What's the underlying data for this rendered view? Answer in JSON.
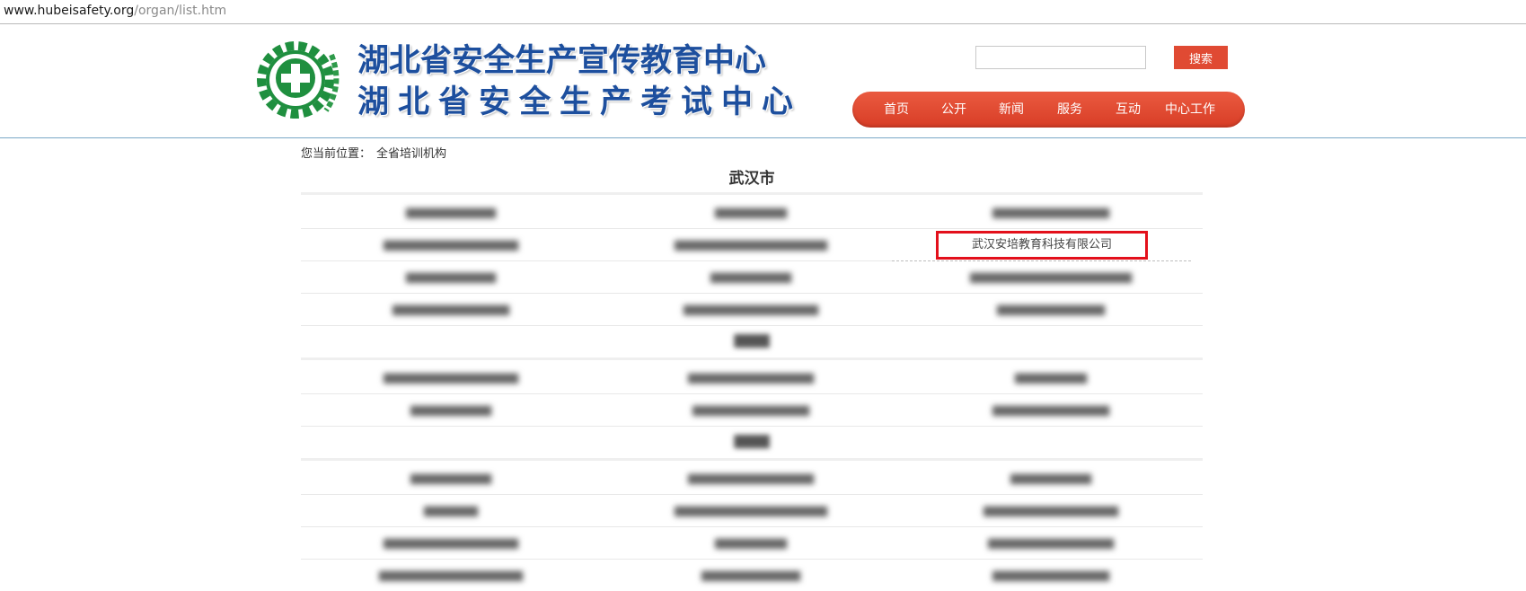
{
  "browser": {
    "url_host": "www.hubeisafety.org",
    "url_path": "/organ/list.htm"
  },
  "header": {
    "title_line1": "湖北省安全生产宣传教育中心",
    "title_line2": "湖北省安全生产考试中心",
    "search_placeholder": "",
    "search_button": "搜索",
    "brand_color": "#1d4f9e",
    "accent_color": "#e04a33"
  },
  "nav": {
    "items": [
      {
        "label": "首页"
      },
      {
        "label": "公开"
      },
      {
        "label": "新闻"
      },
      {
        "label": "服务"
      },
      {
        "label": "互动"
      },
      {
        "label": "中心工作"
      }
    ]
  },
  "breadcrumb": {
    "prefix": "您当前位置：",
    "current": "全省培训机构"
  },
  "sections": [
    {
      "city": "武汉市",
      "rows": [
        [
          "",
          "",
          ""
        ],
        [
          "",
          "",
          "武汉安培教育科技有限公司"
        ],
        [
          "",
          "",
          ""
        ],
        [
          "",
          "",
          ""
        ]
      ]
    },
    {
      "city": "",
      "rows": [
        [
          "",
          "",
          ""
        ],
        [
          "",
          "",
          ""
        ]
      ]
    },
    {
      "city": "",
      "rows": [
        [
          "",
          "",
          ""
        ],
        [
          "",
          "",
          ""
        ],
        [
          "",
          "",
          ""
        ],
        [
          "",
          "",
          ""
        ]
      ]
    }
  ],
  "highlight_color": "#e3101b"
}
